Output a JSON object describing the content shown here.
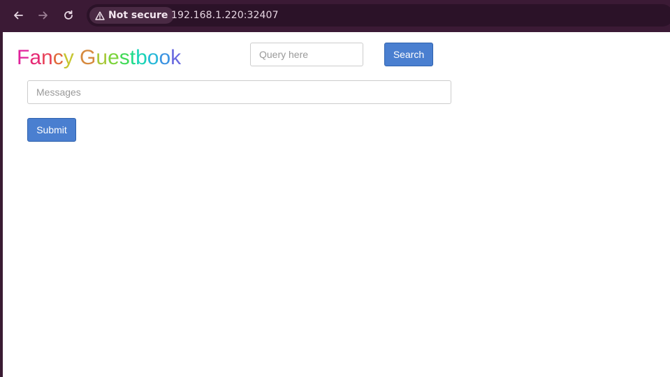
{
  "browser": {
    "security_label": "Not secure",
    "url": "192.168.1.220:32407",
    "icons": [
      "back-arrow-icon",
      "forward-arrow-icon",
      "reload-icon",
      "warning-triangle-icon"
    ]
  },
  "header": {
    "brand_letters": [
      {
        "char": "F",
        "color": "#e0229b"
      },
      {
        "char": "a",
        "color": "#e62a75"
      },
      {
        "char": "n",
        "color": "#e8445a"
      },
      {
        "char": "c",
        "color": "#e06a3a"
      },
      {
        "char": "y",
        "color": "#c6c630"
      },
      {
        "char": " ",
        "color": "#000000"
      },
      {
        "char": "G",
        "color": "#d68a3e"
      },
      {
        "char": "u",
        "color": "#a8c83a"
      },
      {
        "char": "e",
        "color": "#7cd43c"
      },
      {
        "char": "s",
        "color": "#43da58"
      },
      {
        "char": "t",
        "color": "#20dc8a"
      },
      {
        "char": "b",
        "color": "#1bd4b6"
      },
      {
        "char": "o",
        "color": "#28b8d8"
      },
      {
        "char": "o",
        "color": "#3d94e2"
      },
      {
        "char": "k",
        "color": "#6a6ae0"
      }
    ]
  },
  "search": {
    "placeholder": "Query here",
    "button_label": "Search"
  },
  "form": {
    "messages_placeholder": "Messages",
    "submit_label": "Submit"
  },
  "colors": {
    "browser_chrome": "#3b1a35",
    "button_primary": "#4a7fd0",
    "button_border": "#2e61ad"
  }
}
